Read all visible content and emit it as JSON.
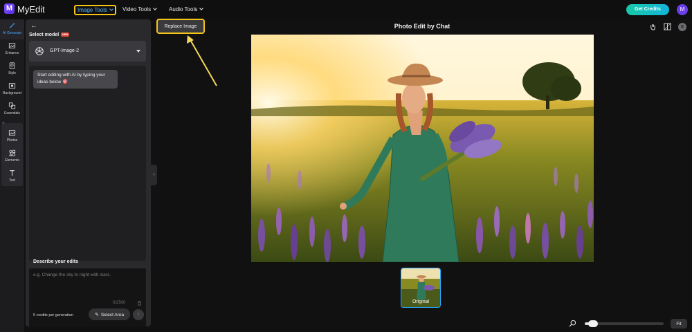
{
  "app": {
    "brand": "MyEdit",
    "logo_letter": "M"
  },
  "nav": {
    "image_tools": "Image Tools",
    "video_tools": "Video Tools",
    "audio_tools": "Audio Tools",
    "get_credits": "Get Credits",
    "avatar_letter": "M"
  },
  "rail": {
    "items": [
      {
        "label": "AI Generate",
        "icon": "magic-wand-icon"
      },
      {
        "label": "Enhance",
        "icon": "image-enhance-icon"
      },
      {
        "label": "Style",
        "icon": "style-icon"
      },
      {
        "label": "Background",
        "icon": "background-icon"
      },
      {
        "label": "Essentials",
        "icon": "essentials-icon"
      },
      {
        "label": "Photos",
        "icon": "photo-icon"
      },
      {
        "label": "Elements",
        "icon": "shapes-icon"
      },
      {
        "label": "Text",
        "icon": "text-icon"
      }
    ]
  },
  "panel": {
    "select_model": "Select model",
    "new_badge": "NEW",
    "model_name": "GPT-Image-2",
    "bubble": "Start editing with AI by typing your ideas below 🎯",
    "describe_label": "Describe your edits",
    "input_placeholder": "e.g. Change the sky to night with stars.",
    "counter": "0/2500",
    "credits_note": "5 credits per generation",
    "select_area": "Select Area"
  },
  "canvas": {
    "replace_image": "Replace Image",
    "title": "Photo Edit by Chat",
    "thumb_label": "Original",
    "fit": "Fit",
    "zoom_level": 0.05
  },
  "colors": {
    "accent_blue": "#2aa8ff",
    "highlight_yellow": "#f5c518",
    "credits_gradient_start": "#18c9a9",
    "credits_gradient_end": "#14b3d8"
  }
}
